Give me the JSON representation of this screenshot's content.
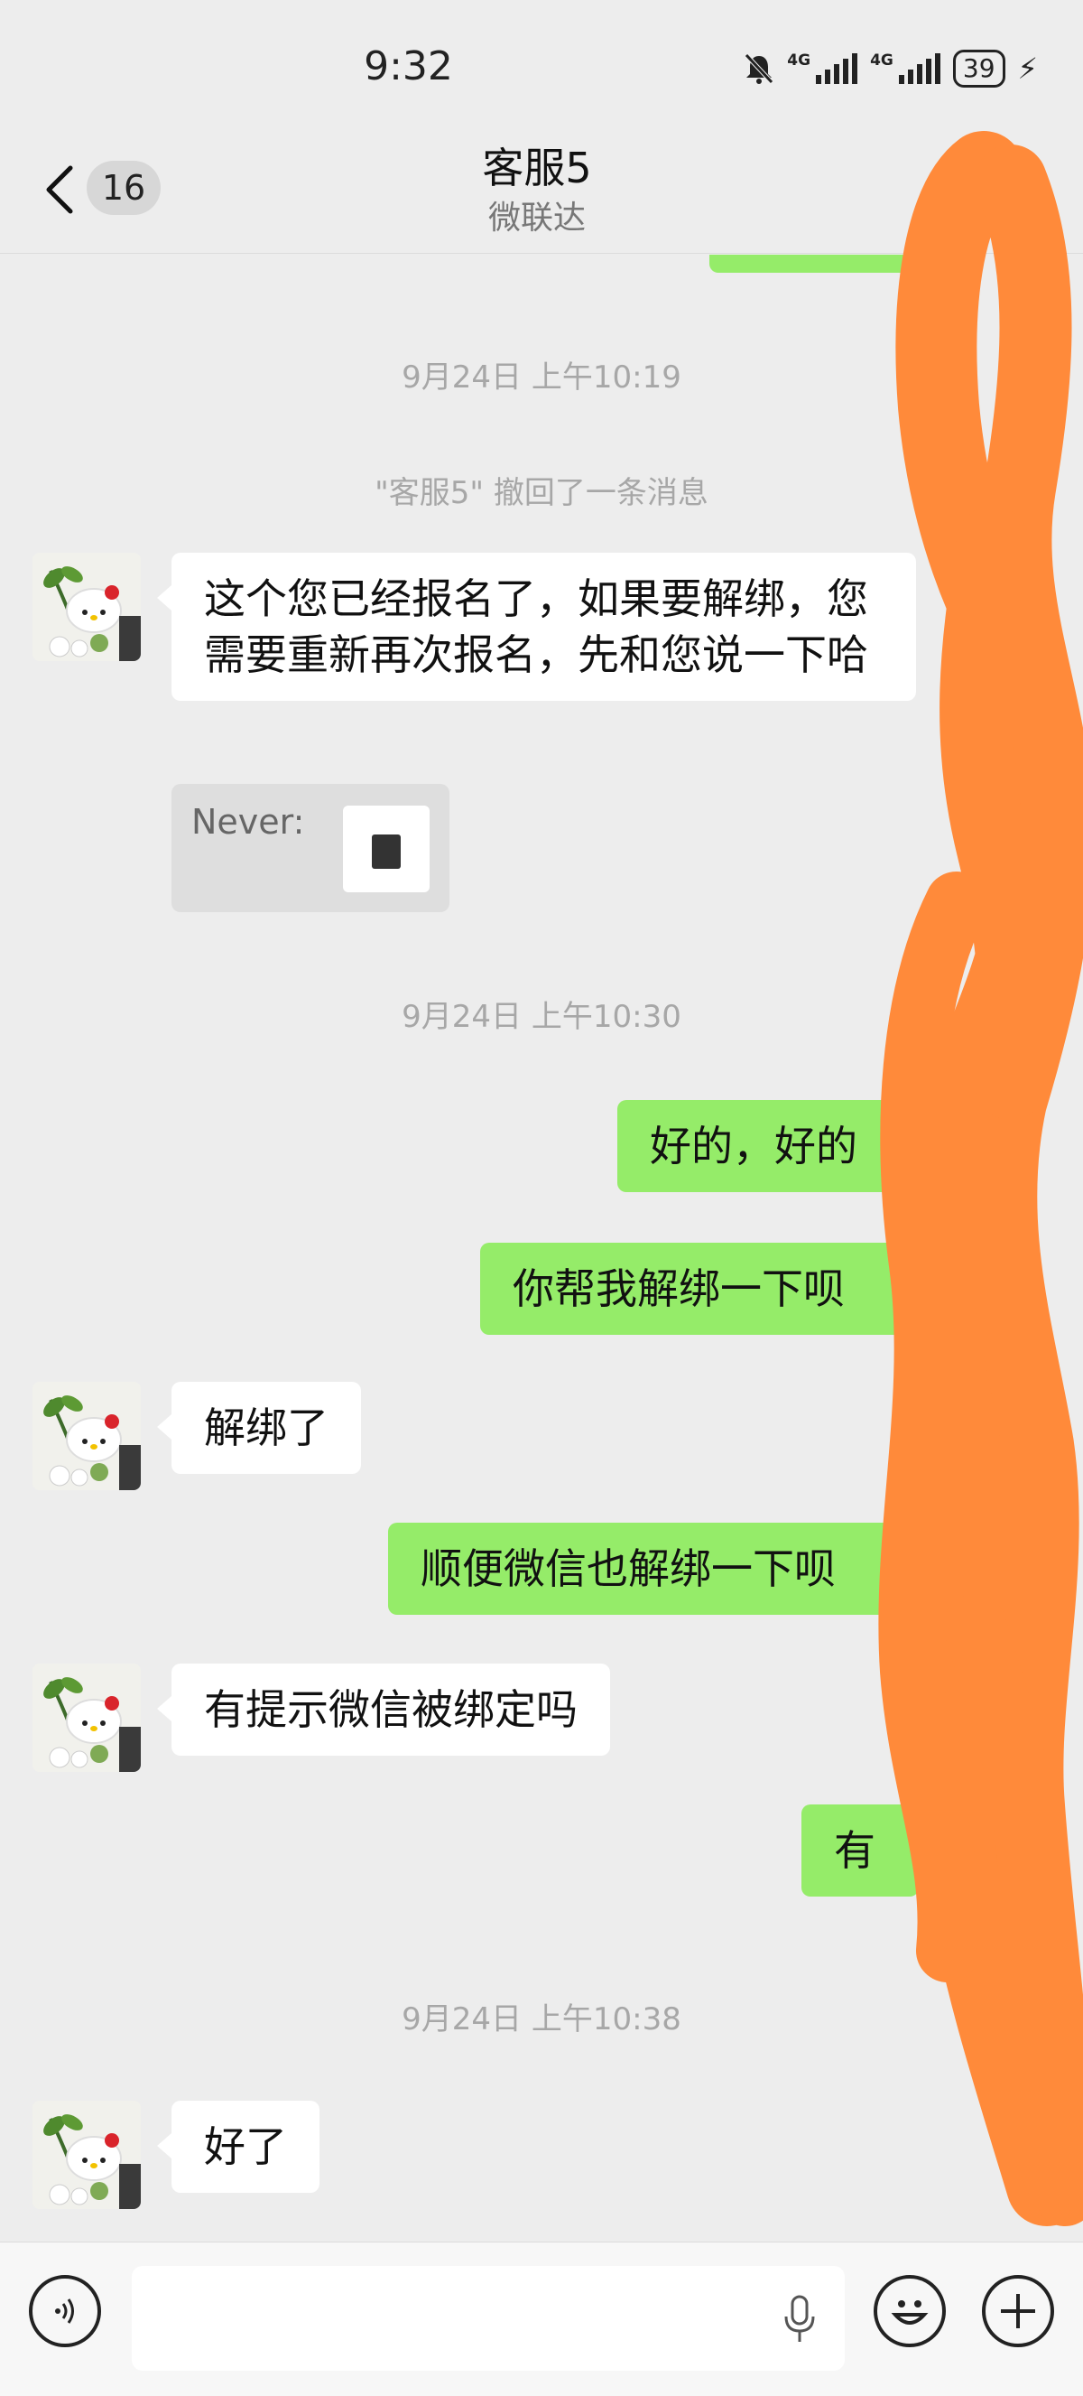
{
  "status_bar": {
    "time": "9:32",
    "network_1": "4G",
    "network_2": "4G",
    "battery": "39"
  },
  "header": {
    "unread_count": "16",
    "title": "客服5",
    "subtitle": "微联达"
  },
  "messages": {
    "ts1": "9月24日 上午10:19",
    "recall_notice": "\"客服5\" 撤回了一条消息",
    "m1": "这个您已经报名了，如果要解绑，您需要重新再次报名，先和您说一下哈",
    "quote_label": "Never:",
    "ts2": "9月24日 上午10:30",
    "m2": "好的，好的",
    "m3": "你帮我解绑一下呗",
    "m4": "解绑了",
    "m5": "顺便微信也解绑一下呗",
    "m6": "有提示微信被绑定吗",
    "m7": "有",
    "ts3": "9月24日 上午10:38",
    "m8": "好了"
  },
  "colors": {
    "background": "#ededed",
    "outgoing_bubble": "#95ec69",
    "incoming_bubble": "#ffffff",
    "scribble": "#ff8a3a"
  }
}
